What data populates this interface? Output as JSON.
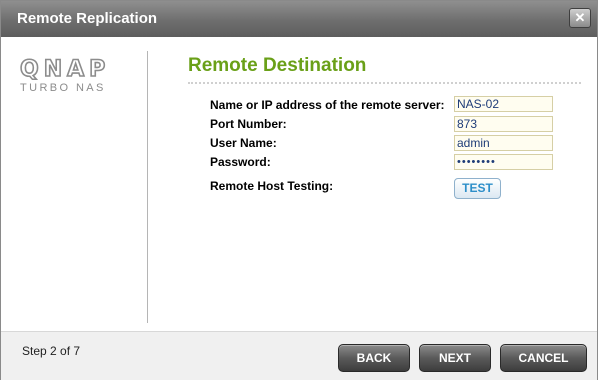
{
  "window": {
    "title": "Remote Replication",
    "close_glyph": "✕"
  },
  "logo": {
    "main": "QNAP",
    "sub": "TURBO NAS"
  },
  "section": {
    "title": "Remote Destination"
  },
  "form": {
    "server_label": "Name or IP address of the remote server:",
    "server_value": "NAS-02",
    "port_label": "Port Number:",
    "port_value": "873",
    "user_label": "User Name:",
    "user_value": "admin",
    "password_label": "Password:",
    "password_value": "••••••••",
    "testing_label": "Remote Host Testing:",
    "test_button": "TEST"
  },
  "footer": {
    "step": "Step 2 of 7",
    "back": "BACK",
    "next": "NEXT",
    "cancel": "CANCEL"
  },
  "colors": {
    "accent_green": "#6aa018",
    "button_dark": "#4a4a4a",
    "titlebar": "#6e6e6e"
  },
  "icons": {
    "close": "close-icon"
  }
}
